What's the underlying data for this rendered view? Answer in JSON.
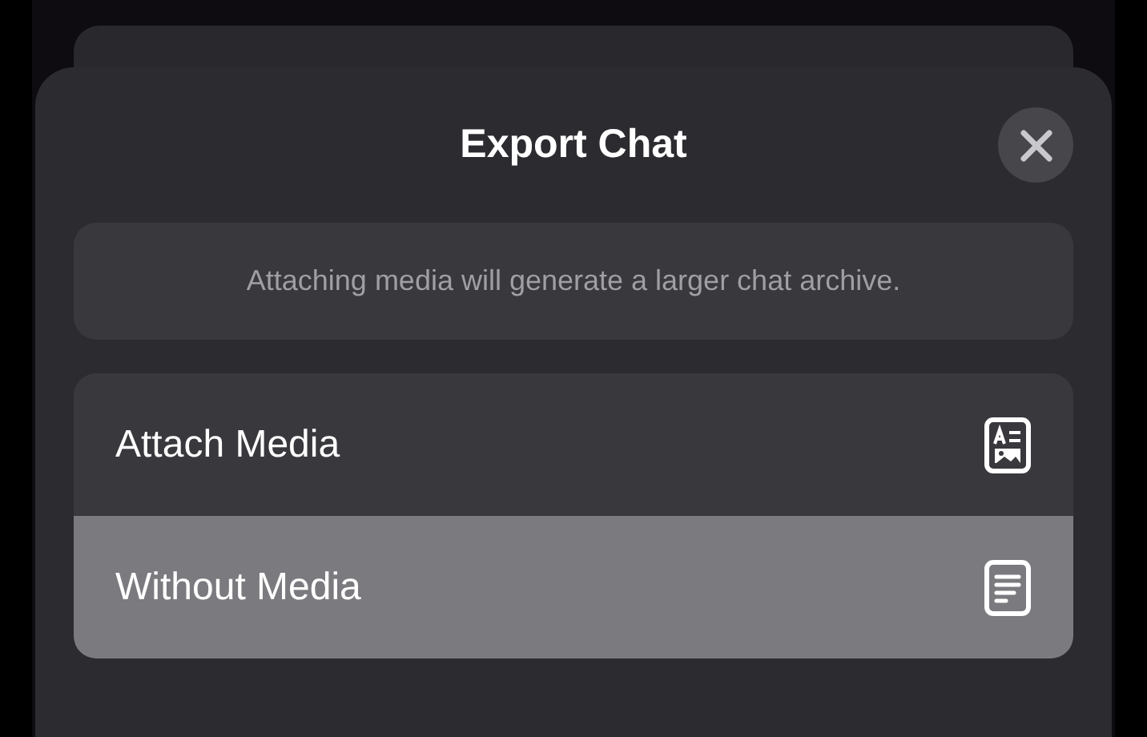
{
  "sheet": {
    "title": "Export Chat"
  },
  "info": "Attaching media will generate a larger chat archive.",
  "options": [
    {
      "label": "Attach Media",
      "kind": "media",
      "selected": false
    },
    {
      "label": "Without Media",
      "kind": "text",
      "selected": true
    }
  ]
}
